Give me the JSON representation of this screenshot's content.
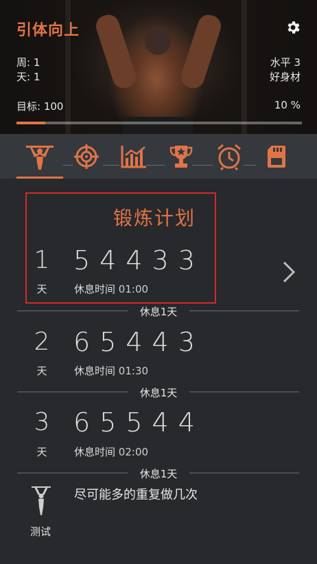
{
  "header": {
    "title": "引体向上",
    "settings_icon": "gear-icon",
    "week_label": "周: 1",
    "day_label": "天: 1",
    "level_label": "水平 3",
    "rank_label": "好身材",
    "goal_label": "目标: 100",
    "progress_text": "10 %",
    "progress_value": 0.1,
    "accent_color": "#e07448"
  },
  "tabs": [
    {
      "name": "pullup-icon",
      "active": true
    },
    {
      "name": "target-icon",
      "active": false
    },
    {
      "name": "chart-icon",
      "active": false
    },
    {
      "name": "trophy-icon",
      "active": false
    },
    {
      "name": "alarm-clock-icon",
      "active": false
    },
    {
      "name": "sd-card-icon",
      "active": false
    }
  ],
  "plan": {
    "title": "锻炼计划",
    "days": [
      {
        "day": "1",
        "unit": "天",
        "reps": "54433",
        "rest_label": "休息时间",
        "rest_time": "01:00"
      },
      {
        "day": "2",
        "unit": "天",
        "reps": "65443",
        "rest_label": "休息时间",
        "rest_time": "01:30"
      },
      {
        "day": "3",
        "unit": "天",
        "reps": "65544",
        "rest_label": "休息时间",
        "rest_time": "02:00"
      }
    ],
    "rest_day_label": "休息1天",
    "test": {
      "label": "测试",
      "description": "尽可能多的重复做几次"
    }
  }
}
